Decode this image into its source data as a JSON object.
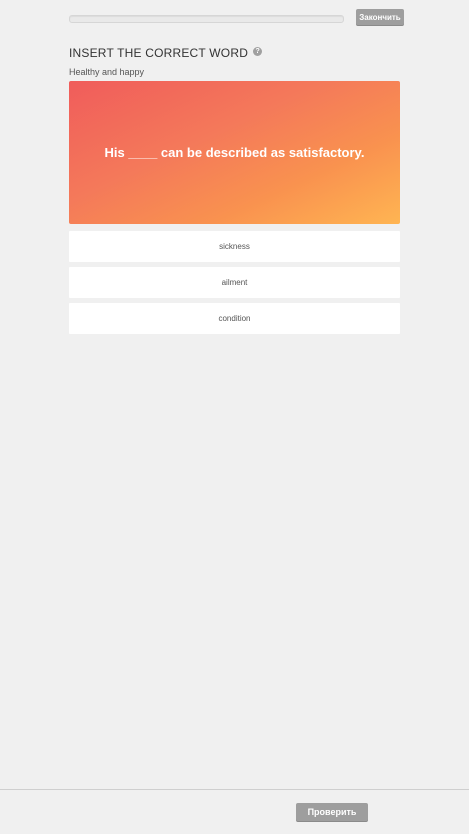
{
  "header": {
    "progress_fraction": 0,
    "finish_label": "Закончить"
  },
  "task": {
    "title": "INSERT THE CORRECT WORD",
    "help_icon": "question-circle-icon",
    "subtitle": "Healthy and happy"
  },
  "question": {
    "text": "His ____ can be described as satisfactory.",
    "gradient_colors": [
      "#f05c5b",
      "#ffb552"
    ]
  },
  "options": [
    {
      "label": "sickness"
    },
    {
      "label": "ailment"
    },
    {
      "label": "condition"
    }
  ],
  "footer": {
    "check_label": "Проверить"
  }
}
